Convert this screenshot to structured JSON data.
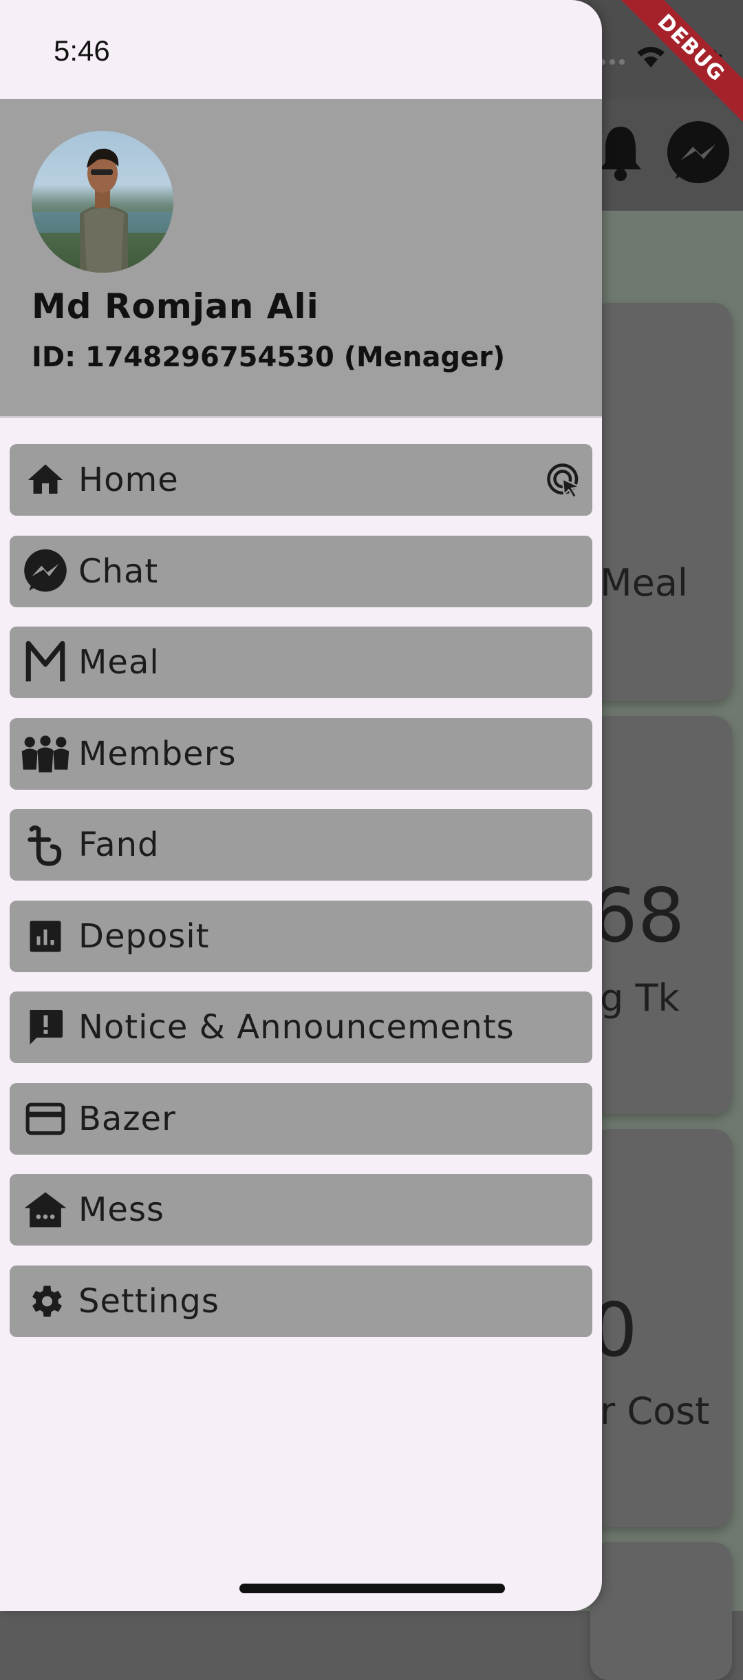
{
  "status_bar": {
    "time": "5:46"
  },
  "debug_banner": "DEBUG",
  "drawer": {
    "header": {
      "user_name": "Md Romjan Ali",
      "user_id_line": "ID: 1748296754530  (Menager)"
    },
    "menu_items": [
      {
        "label": "Home",
        "icon": "home-icon",
        "trailing_icon": "touch-app-icon"
      },
      {
        "label": "Chat",
        "icon": "messenger-icon"
      },
      {
        "label": "Meal",
        "icon": "letter-m-icon"
      },
      {
        "label": "Members",
        "icon": "group-icon"
      },
      {
        "label": "Fand",
        "icon": "taka-icon"
      },
      {
        "label": "Deposit",
        "icon": "bar-chart-icon"
      },
      {
        "label": "Notice & Announcements",
        "icon": "announcement-icon"
      },
      {
        "label": "Bazer",
        "icon": "credit-card-icon"
      },
      {
        "label": "Mess",
        "icon": "house-icon"
      },
      {
        "label": "Settings",
        "icon": "gear-icon"
      }
    ]
  },
  "background_app": {
    "card_texts": [
      "Meal",
      "68",
      "g Tk",
      "0",
      "r Cost"
    ]
  },
  "colors": {
    "drawer_background": "#f7eff8",
    "header_background": "#a0a0a0",
    "menu_item_background": "#9d9d9d",
    "debug_banner": "#a5222b"
  }
}
